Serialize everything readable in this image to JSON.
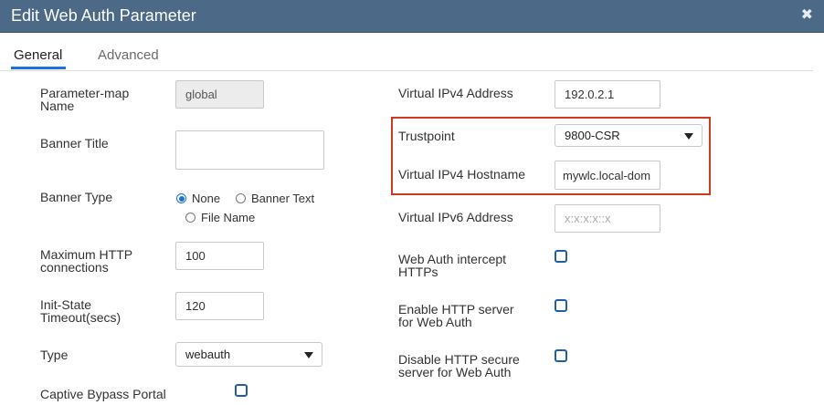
{
  "dialog": {
    "title": "Edit Web Auth Parameter",
    "close_icon": "close-icon"
  },
  "tabs": [
    {
      "label": "General",
      "active": true
    },
    {
      "label": "Advanced",
      "active": false
    }
  ],
  "left": {
    "param_map_name": {
      "label": "Parameter-map\nName",
      "value": "global"
    },
    "banner_title": {
      "label": "Banner Title",
      "value": ""
    },
    "banner_type": {
      "label": "Banner Type",
      "options": [
        {
          "label": "None",
          "checked": true
        },
        {
          "label": "Banner Text",
          "checked": false
        },
        {
          "label": "File Name",
          "checked": false
        }
      ]
    },
    "max_http": {
      "label": "Maximum HTTP\nconnections",
      "value": "100"
    },
    "init_state": {
      "label": "Init-State\nTimeout(secs)",
      "value": "120"
    },
    "type": {
      "label": "Type",
      "value": "webauth"
    },
    "captive_bypass": {
      "label": "Captive Bypass Portal",
      "checked": false
    }
  },
  "right": {
    "virtual_ipv4": {
      "label": "Virtual IPv4 Address",
      "value": "192.0.2.1"
    },
    "trustpoint": {
      "label": "Trustpoint",
      "value": "9800-CSR"
    },
    "virtual_ipv4_hostname": {
      "label": "Virtual IPv4 Hostname",
      "value": "mywlc.local-dom"
    },
    "virtual_ipv6": {
      "label": "Virtual IPv6 Address",
      "placeholder": "x:x:x:x::x"
    },
    "intercept_https": {
      "label": "Web Auth intercept\nHTTPs",
      "checked": false
    },
    "enable_http": {
      "label": "Enable HTTP server\nfor Web Auth",
      "checked": false
    },
    "disable_https": {
      "label": "Disable HTTP secure\nserver for Web Auth",
      "checked": false
    }
  },
  "colors": {
    "title_bar": "#4c6a87",
    "accent": "#1a73d9",
    "highlight_border": "#d1381f"
  }
}
